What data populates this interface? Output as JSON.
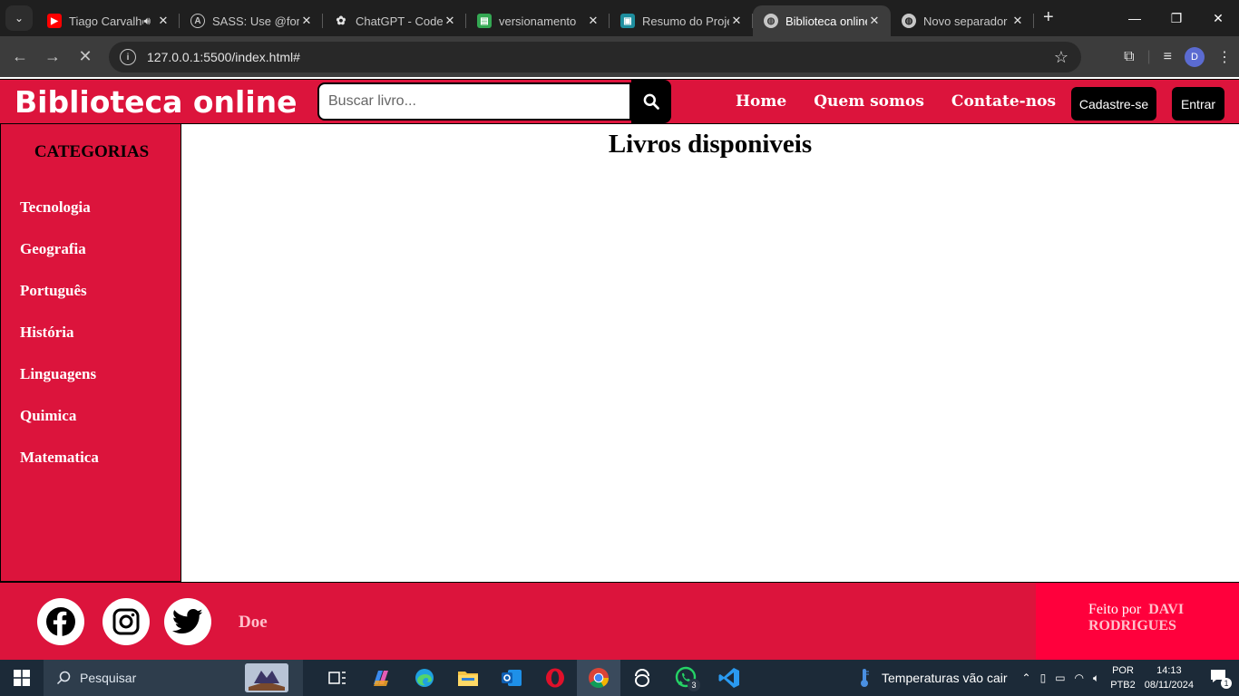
{
  "browser": {
    "tabs": [
      {
        "title": "Tiago Carvalho",
        "favicon": "youtube-icon",
        "audible": true
      },
      {
        "title": "SASS: Use @forward",
        "favicon": "angular-icon"
      },
      {
        "title": "ChatGPT - Codes",
        "favicon": "chatgpt-icon"
      },
      {
        "title": "versionamento",
        "favicon": "sheets-icon"
      },
      {
        "title": "Resumo do Projeto",
        "favicon": "classroom-icon"
      },
      {
        "title": "Biblioteca online",
        "favicon": "globe-icon",
        "active": true
      },
      {
        "title": "Novo separador",
        "favicon": "globe-icon"
      }
    ],
    "url": "127.0.0.1:5500/index.html#",
    "profile_initial": "D"
  },
  "site": {
    "logo": "Biblioteca online",
    "search": {
      "placeholder": "Buscar livro...",
      "value": ""
    },
    "nav": [
      "Home",
      "Quem somos",
      "Contate-nos"
    ],
    "signup_label": "Cadastre-se",
    "login_label": "Entrar",
    "brand_color": "#dc143c"
  },
  "sidebar": {
    "title": "CATEGORIAS",
    "categories": [
      "Tecnologia",
      "Geografia",
      "Português",
      "História",
      "Linguagens",
      "Quimica",
      "Matematica"
    ]
  },
  "main": {
    "title": "Livros disponiveis"
  },
  "footer": {
    "social": [
      "facebook-icon",
      "instagram-icon",
      "twitter-icon"
    ],
    "donate_label": "Doe",
    "credit_prefix": "Feito por",
    "credit_name": "DAVI RODRIGUES"
  },
  "taskbar": {
    "search_placeholder": "Pesquisar",
    "weather_text": "Temperaturas vão cair",
    "language": "POR",
    "layout": "PTB2",
    "time": "14:13",
    "date": "08/11/2024",
    "whatsapp_badge": "3",
    "notification_count": "1"
  }
}
